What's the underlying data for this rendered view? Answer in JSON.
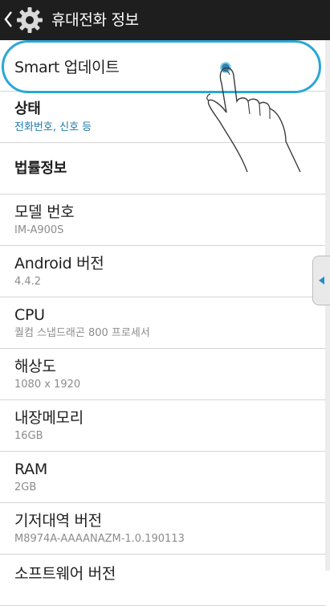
{
  "header": {
    "title": "휴대전화 정보",
    "background": "#1e1e1e"
  },
  "icons": {
    "back": "chevron-left-icon",
    "settings": "gear-icon",
    "hand": "pointing-hand-icon",
    "side_handle": "triangle-left-icon"
  },
  "highlight_color": "#2aa7d6",
  "items": [
    {
      "title": "Smart 업데이트"
    },
    {
      "title": "상태",
      "subtitle": "전화번호, 신호 등"
    },
    {
      "title": "법률정보"
    },
    {
      "title": "모델 번호",
      "subtitle": "IM-A900S"
    },
    {
      "title": "Android 버전",
      "subtitle": "4.4.2"
    },
    {
      "title": "CPU",
      "subtitle": "퀄컴 스냅드래곤 800 프로세서"
    },
    {
      "title": "해상도",
      "subtitle": "1080 x 1920"
    },
    {
      "title": "내장메모리",
      "subtitle": "16GB"
    },
    {
      "title": "RAM",
      "subtitle": "2GB"
    },
    {
      "title": "기저대역 버전",
      "subtitle": "M8974A-AAAANAZM-1.0.190113"
    },
    {
      "title": "소프트웨어 버전"
    }
  ]
}
